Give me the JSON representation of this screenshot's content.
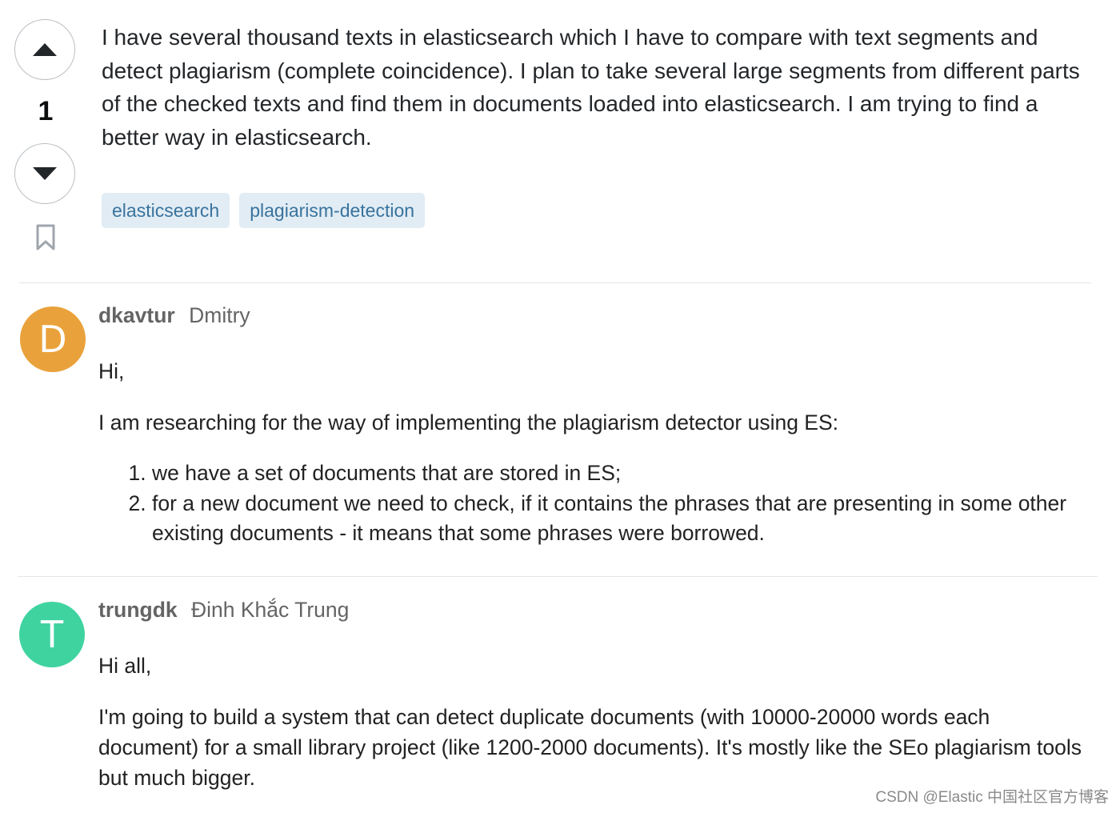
{
  "question": {
    "vote_count": "1",
    "body": "I have several thousand texts in elasticsearch which I have to compare with text segments and detect plagiarism (complete coincidence). I plan to take several large segments from different parts of the checked texts and find them in documents loaded into elasticsearch. I am trying to find a better way in elasticsearch.",
    "tags": [
      "elasticsearch",
      "plagiarism-detection"
    ],
    "icons": {
      "upvote": "caret-up-icon",
      "downvote": "caret-down-icon",
      "bookmark": "bookmark-icon"
    }
  },
  "posts": [
    {
      "avatar_letter": "D",
      "avatar_color": "#e9a23b",
      "username": "dkavtur",
      "fullname": "Dmitry",
      "greeting": "Hi,",
      "paragraph": "I am researching for the way of implementing the plagiarism detector using ES:",
      "list": [
        "we have a set of documents that are stored in ES;",
        "for a new document we need to check, if it contains the phrases that are presenting in some other existing documents - it means that some phrases were borrowed."
      ]
    },
    {
      "avatar_letter": "T",
      "avatar_color": "#3fd3a0",
      "username": "trungdk",
      "fullname": "Đinh Khắc Trung",
      "greeting": "Hi all,",
      "paragraph": "I'm going to build a system that can detect duplicate documents (with 10000-20000 words each document) for a small library project (like 1200-2000 documents). It's mostly like the SEo plagiarism tools but much bigger."
    }
  ],
  "watermark": "CSDN @Elastic 中国社区官方博客"
}
